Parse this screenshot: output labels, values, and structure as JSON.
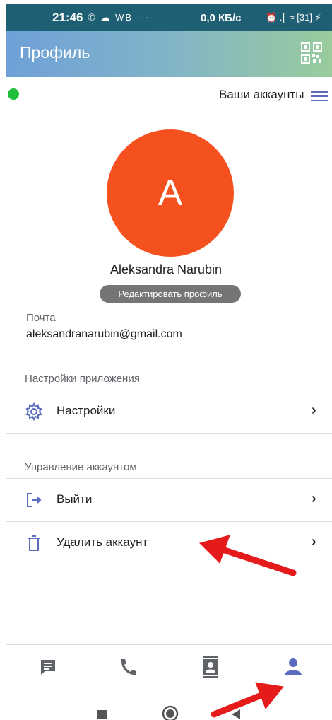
{
  "status_bar": {
    "time": "21:46",
    "left_icons": "✆ ☁ WB ···",
    "net_speed": "0,0 КБ/с",
    "right_icons": "⏰ .∥ ≈ [31] ⚡"
  },
  "app_bar": {
    "title": "Профиль"
  },
  "profile": {
    "accounts_label": "Ваши аккаунты",
    "avatar_letter": "A",
    "name": "Aleksandra Narubin",
    "edit_label": "Редактировать профиль",
    "mail_label": "Почта",
    "mail_value": "aleksandranarubin@gmail.com"
  },
  "sections": {
    "app_settings_title": "Настройки приложения",
    "settings_label": "Настройки",
    "account_mgmt_title": "Управление аккаунтом",
    "logout_label": "Выйти",
    "delete_label": "Удалить аккаунт"
  },
  "colors": {
    "accent": "#5c6bc0",
    "avatar": "#f4511e",
    "online": "#1fbf3a",
    "annotation": "#e51b1b"
  },
  "bottom_nav": {
    "items": [
      "chat-icon",
      "phone-icon",
      "contacts-icon",
      "profile-icon"
    ],
    "active": "profile-icon"
  }
}
